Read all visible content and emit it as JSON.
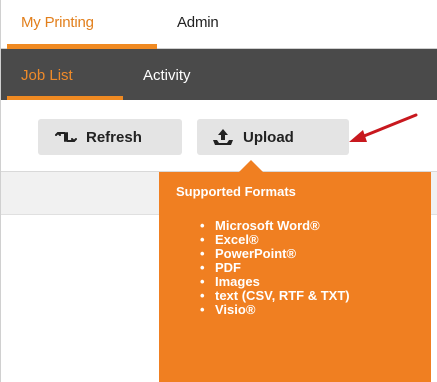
{
  "top_nav": {
    "tabs": [
      {
        "label": "My Printing",
        "active": true
      },
      {
        "label": "Admin",
        "active": false
      }
    ]
  },
  "sub_nav": {
    "tabs": [
      {
        "label": "Job List",
        "active": true
      },
      {
        "label": "Activity",
        "active": false
      }
    ]
  },
  "toolbar": {
    "refresh_label": "Refresh",
    "refresh_icon": "refresh-icon",
    "upload_label": "Upload",
    "upload_icon": "upload-icon"
  },
  "popover": {
    "title": "Supported Formats",
    "formats": [
      "Microsoft Word®",
      "Excel®",
      "PowerPoint®",
      "PDF",
      "Images",
      "text (CSV, RTF & TXT)",
      "Visio®"
    ]
  },
  "colors": {
    "accent": "#f07f21",
    "subnav_bg": "#4a4a4a",
    "arrow": "#c8181e"
  }
}
